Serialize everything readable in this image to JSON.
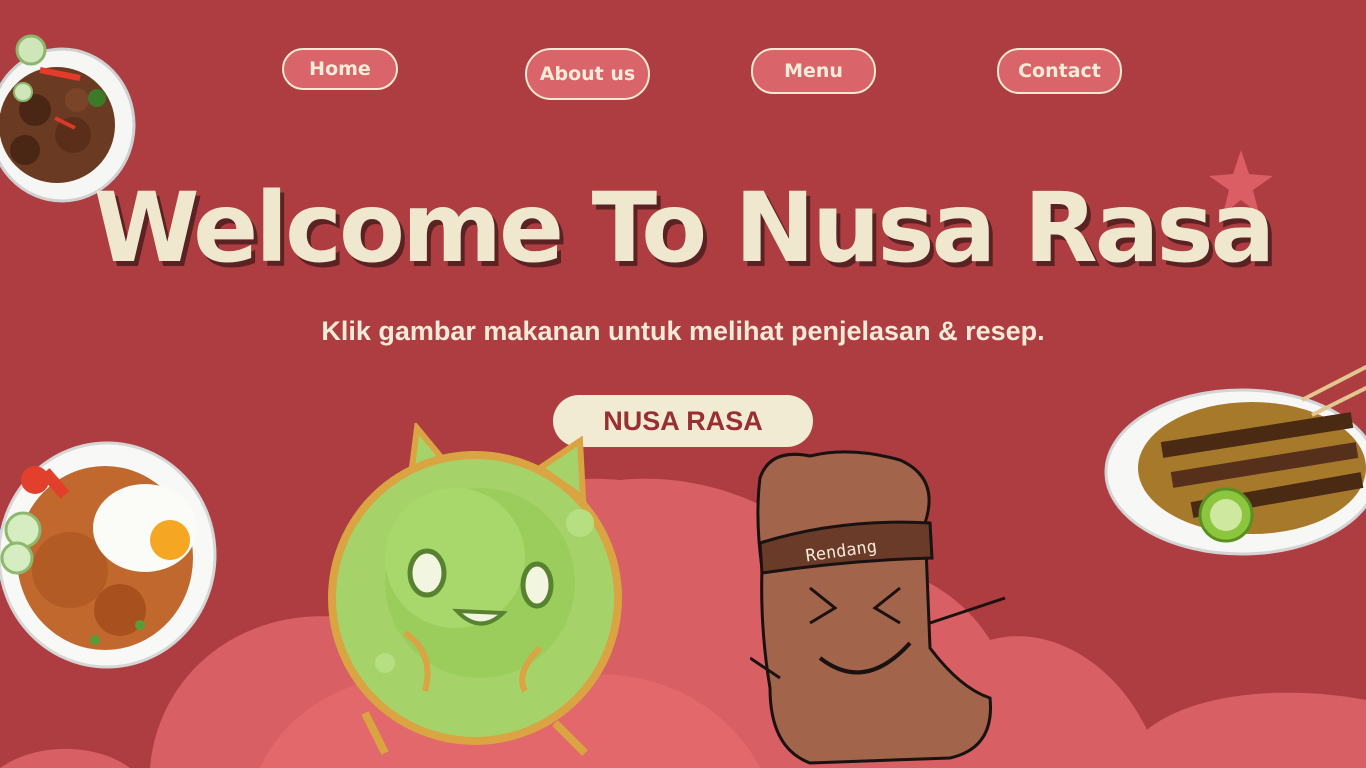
{
  "nav": {
    "home": "Home",
    "about": "About us",
    "menu": "Menu",
    "contact": "Contact"
  },
  "hero": {
    "title": "Welcome To Nusa Rasa",
    "subtitle": "Klik gambar makanan untuk melihat penjelasan & resep.",
    "cta": "NUSA RASA"
  },
  "characters": {
    "rendang_label": "Rendang"
  },
  "colors": {
    "background": "#ad3d40",
    "cream": "#efe8cf",
    "button_fill": "#d9656a",
    "blob_light": "#e06a6d"
  }
}
